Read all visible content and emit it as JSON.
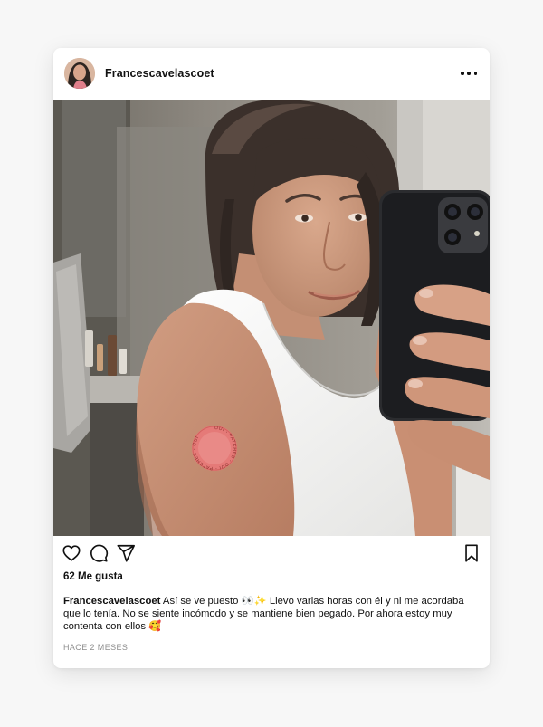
{
  "post": {
    "username": "Francescavelascoet",
    "likes_text": "62 Me gusta",
    "caption": {
      "username": "Francescavelascoet",
      "text": "Así se ve puesto 👀✨ Llevo varias horas con él y ni me acordaba que lo tenía. No se siente incómodo y se mantiene bien pegado. Por ahora estoy muy contenta con ellos 🥰"
    },
    "timestamp": "HACE 2 MESES",
    "patch_text": "OUI - PATCHES - OUI - PATCHES - OUI"
  },
  "icons": {
    "more": "more-options-icon",
    "like": "heart-icon",
    "comment": "comment-icon",
    "share": "share-icon",
    "save": "bookmark-icon"
  },
  "colors": {
    "text": "#111111",
    "muted": "#8e8e8e",
    "patch": "#e57a78"
  }
}
